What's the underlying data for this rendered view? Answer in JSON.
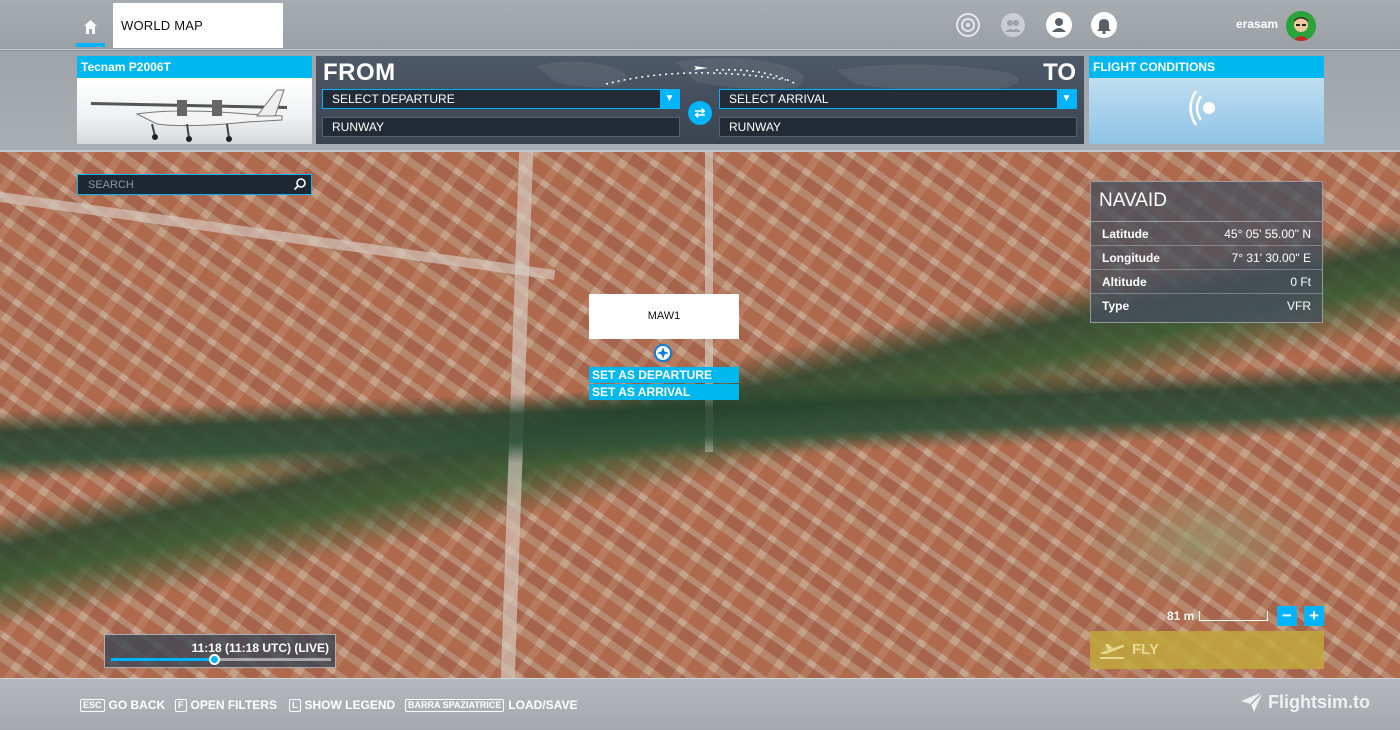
{
  "topbar": {
    "world_map_tab": "WORLD MAP",
    "username": "erasam"
  },
  "aircraft": {
    "name": "Tecnam P2006T"
  },
  "route": {
    "from_label": "FROM",
    "to_label": "TO",
    "departure_select": "SELECT DEPARTURE",
    "arrival_select": "SELECT ARRIVAL",
    "departure_runway": "RUNWAY",
    "arrival_runway": "RUNWAY"
  },
  "conditions": {
    "title": "FLIGHT CONDITIONS"
  },
  "search": {
    "placeholder": "SEARCH"
  },
  "waypoint": {
    "name": "MAW1",
    "set_departure": "SET AS DEPARTURE",
    "set_arrival": "SET AS ARRIVAL"
  },
  "navaid": {
    "title": "NAVAID",
    "rows": [
      {
        "label": "Latitude",
        "value": "45° 05' 55.00\" N"
      },
      {
        "label": "Longitude",
        "value": "7° 31' 30.00\" E"
      },
      {
        "label": "Altitude",
        "value": "0 Ft"
      },
      {
        "label": "Type",
        "value": "VFR"
      }
    ]
  },
  "map": {
    "scale": "81 m",
    "zoom_out": "−",
    "zoom_in": "+"
  },
  "fly": {
    "label": "FLY"
  },
  "time": {
    "text": "11:18 (11:18 UTC) (LIVE)",
    "progress": 0.47
  },
  "bottombar": {
    "hints": [
      {
        "key": "ESC",
        "label": "GO BACK"
      },
      {
        "key": "F",
        "label": "OPEN FILTERS"
      },
      {
        "key": "L",
        "label": "SHOW LEGEND"
      },
      {
        "key": "BARRA SPAZIATRICE",
        "label": "LOAD/SAVE"
      }
    ],
    "brand": "Flightsim.to"
  },
  "colors": {
    "accent": "#00b4ff",
    "fly": "#c1a83c",
    "panel": "#3a4350"
  },
  "icons": [
    "home-icon",
    "activity-icon",
    "friends-icon",
    "profile-icon",
    "notification-icon",
    "search-icon",
    "swap-icon",
    "chevron-down-icon",
    "wind-icon",
    "waypoint-icon",
    "plane-takeoff-icon",
    "flightsim-logo-icon"
  ]
}
